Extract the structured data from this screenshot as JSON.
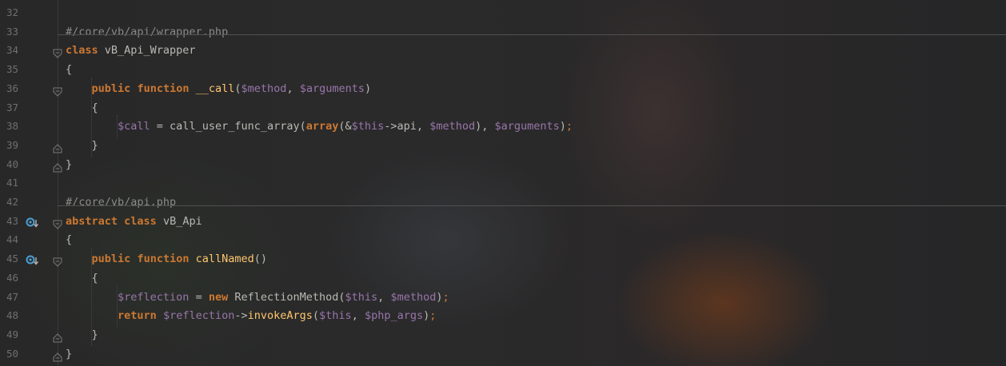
{
  "editor": {
    "lines": [
      {
        "num": "32",
        "tokens": []
      },
      {
        "num": "33",
        "tokens": [
          {
            "t": "#/core/vb/api/wrapper.php",
            "c": "cm"
          }
        ]
      },
      {
        "num": "34",
        "fold": "open",
        "tokens": [
          {
            "t": "class",
            "c": "kw"
          },
          {
            "t": " vB_Api_Wrapper",
            "c": "pl"
          }
        ]
      },
      {
        "num": "35",
        "tokens": [
          {
            "t": "{",
            "c": "pl"
          }
        ]
      },
      {
        "num": "36",
        "fold": "open",
        "tokens": [
          {
            "t": "    ",
            "c": "pl"
          },
          {
            "t": "public",
            "c": "kw"
          },
          {
            "t": " ",
            "c": "pl"
          },
          {
            "t": "function",
            "c": "kw"
          },
          {
            "t": " ",
            "c": "pl"
          },
          {
            "t": "__call",
            "c": "fn"
          },
          {
            "t": "(",
            "c": "pl"
          },
          {
            "t": "$method",
            "c": "var"
          },
          {
            "t": ", ",
            "c": "pl"
          },
          {
            "t": "$arguments",
            "c": "var"
          },
          {
            "t": ")",
            "c": "pl"
          }
        ]
      },
      {
        "num": "37",
        "tokens": [
          {
            "t": "    {",
            "c": "pl"
          }
        ]
      },
      {
        "num": "38",
        "tokens": [
          {
            "t": "        ",
            "c": "pl"
          },
          {
            "t": "$call",
            "c": "var"
          },
          {
            "t": " = call_user_func_array(",
            "c": "pl"
          },
          {
            "t": "array",
            "c": "kw"
          },
          {
            "t": "(&",
            "c": "pl"
          },
          {
            "t": "$this",
            "c": "var"
          },
          {
            "t": "->api, ",
            "c": "pl"
          },
          {
            "t": "$method",
            "c": "var"
          },
          {
            "t": "), ",
            "c": "pl"
          },
          {
            "t": "$arguments",
            "c": "var"
          },
          {
            "t": ")",
            "c": "pl"
          },
          {
            "t": ";",
            "c": "pn"
          }
        ]
      },
      {
        "num": "39",
        "fold": "end",
        "tokens": [
          {
            "t": "    }",
            "c": "pl"
          }
        ]
      },
      {
        "num": "40",
        "fold": "end",
        "tokens": [
          {
            "t": "}",
            "c": "pl"
          }
        ]
      },
      {
        "num": "41",
        "tokens": []
      },
      {
        "num": "42",
        "tokens": [
          {
            "t": "#/core/vb/api.php",
            "c": "cm"
          }
        ]
      },
      {
        "num": "43",
        "marker": "override",
        "fold": "open",
        "tokens": [
          {
            "t": "abstract",
            "c": "kw"
          },
          {
            "t": " ",
            "c": "pl"
          },
          {
            "t": "class",
            "c": "kw"
          },
          {
            "t": " vB_Api",
            "c": "pl"
          }
        ]
      },
      {
        "num": "44",
        "tokens": [
          {
            "t": "{",
            "c": "pl"
          }
        ]
      },
      {
        "num": "45",
        "marker": "override",
        "fold": "open",
        "tokens": [
          {
            "t": "    ",
            "c": "pl"
          },
          {
            "t": "public",
            "c": "kw"
          },
          {
            "t": " ",
            "c": "pl"
          },
          {
            "t": "function",
            "c": "kw"
          },
          {
            "t": " ",
            "c": "pl"
          },
          {
            "t": "callNamed",
            "c": "fn"
          },
          {
            "t": "()",
            "c": "pl"
          }
        ]
      },
      {
        "num": "46",
        "tokens": [
          {
            "t": "    {",
            "c": "pl"
          }
        ]
      },
      {
        "num": "47",
        "tokens": [
          {
            "t": "        ",
            "c": "pl"
          },
          {
            "t": "$reflection",
            "c": "var"
          },
          {
            "t": " = ",
            "c": "pl"
          },
          {
            "t": "new",
            "c": "kw"
          },
          {
            "t": " ReflectionMethod(",
            "c": "pl"
          },
          {
            "t": "$this",
            "c": "var"
          },
          {
            "t": ", ",
            "c": "pl"
          },
          {
            "t": "$method",
            "c": "var"
          },
          {
            "t": ")",
            "c": "pl"
          },
          {
            "t": ";",
            "c": "pn"
          }
        ]
      },
      {
        "num": "48",
        "tokens": [
          {
            "t": "        ",
            "c": "pl"
          },
          {
            "t": "return",
            "c": "kw"
          },
          {
            "t": " ",
            "c": "pl"
          },
          {
            "t": "$reflection",
            "c": "var"
          },
          {
            "t": "->",
            "c": "pl"
          },
          {
            "t": "invokeArgs",
            "c": "fn"
          },
          {
            "t": "(",
            "c": "pl"
          },
          {
            "t": "$this",
            "c": "var"
          },
          {
            "t": ", ",
            "c": "pl"
          },
          {
            "t": "$php_args",
            "c": "var"
          },
          {
            "t": ")",
            "c": "pl"
          },
          {
            "t": ";",
            "c": "pn"
          }
        ]
      },
      {
        "num": "49",
        "fold": "end",
        "tokens": [
          {
            "t": "    }",
            "c": "pl"
          }
        ]
      },
      {
        "num": "50",
        "fold": "end",
        "tokens": [
          {
            "t": "}",
            "c": "pl"
          }
        ]
      }
    ]
  },
  "colors": {
    "keyword": "#cc7832",
    "function": "#ffc66d",
    "variable": "#9876aa",
    "comment": "#8a8a8a",
    "text": "#b9b9b4",
    "line_number": "#6f6f6f",
    "override_marker": "#4a9fd4"
  },
  "icons": {
    "override": "override-marker-icon",
    "fold_open": "fold-open-icon",
    "fold_end": "fold-end-icon"
  }
}
